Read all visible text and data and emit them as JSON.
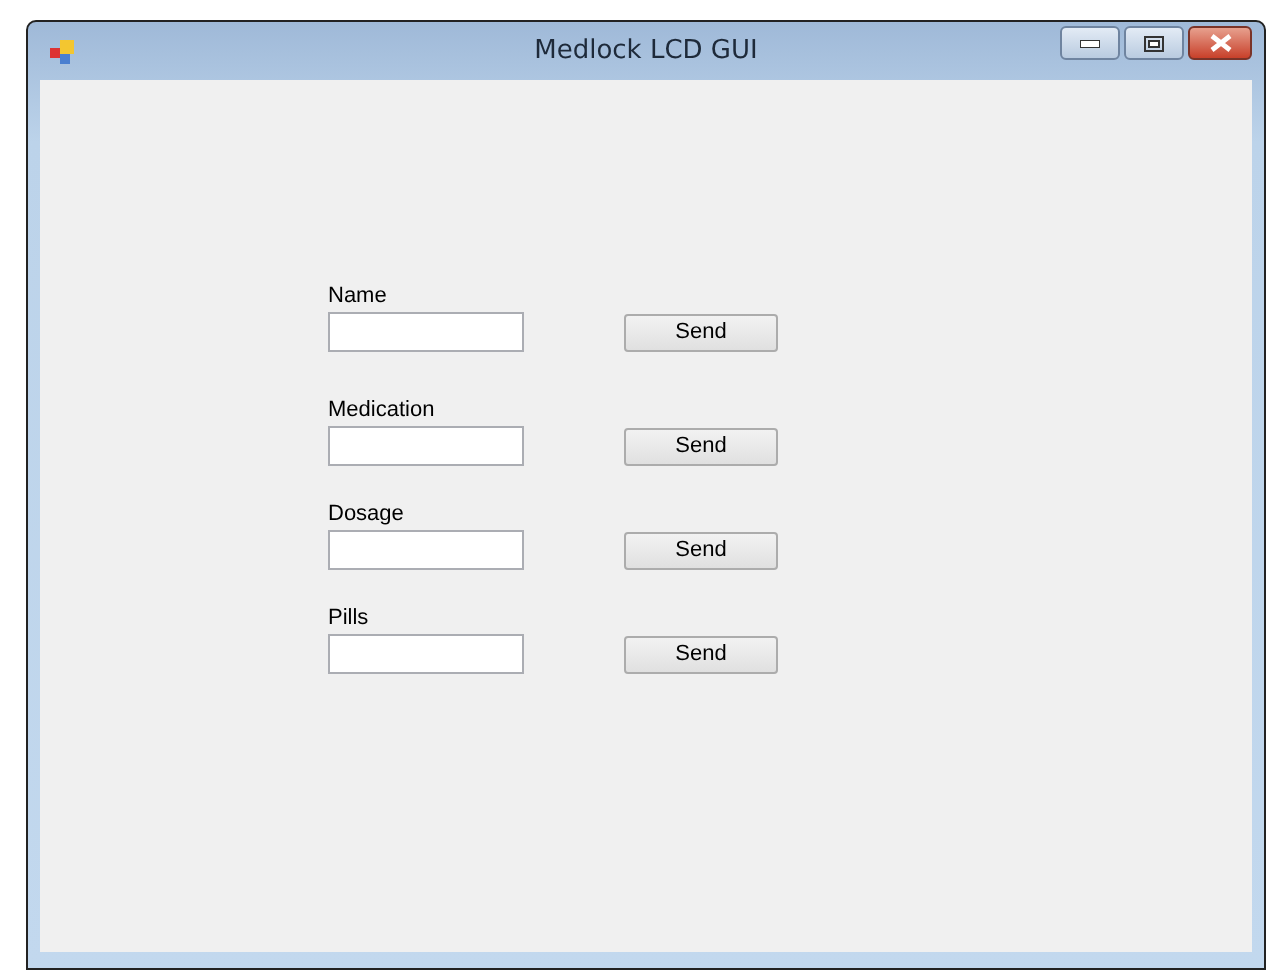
{
  "window": {
    "title": "Medlock LCD GUI"
  },
  "fields": [
    {
      "label": "Name",
      "button": "Send"
    },
    {
      "label": "Medication",
      "button": "Send"
    },
    {
      "label": "Dosage",
      "button": "Send"
    },
    {
      "label": "Pills",
      "button": "Send"
    }
  ]
}
